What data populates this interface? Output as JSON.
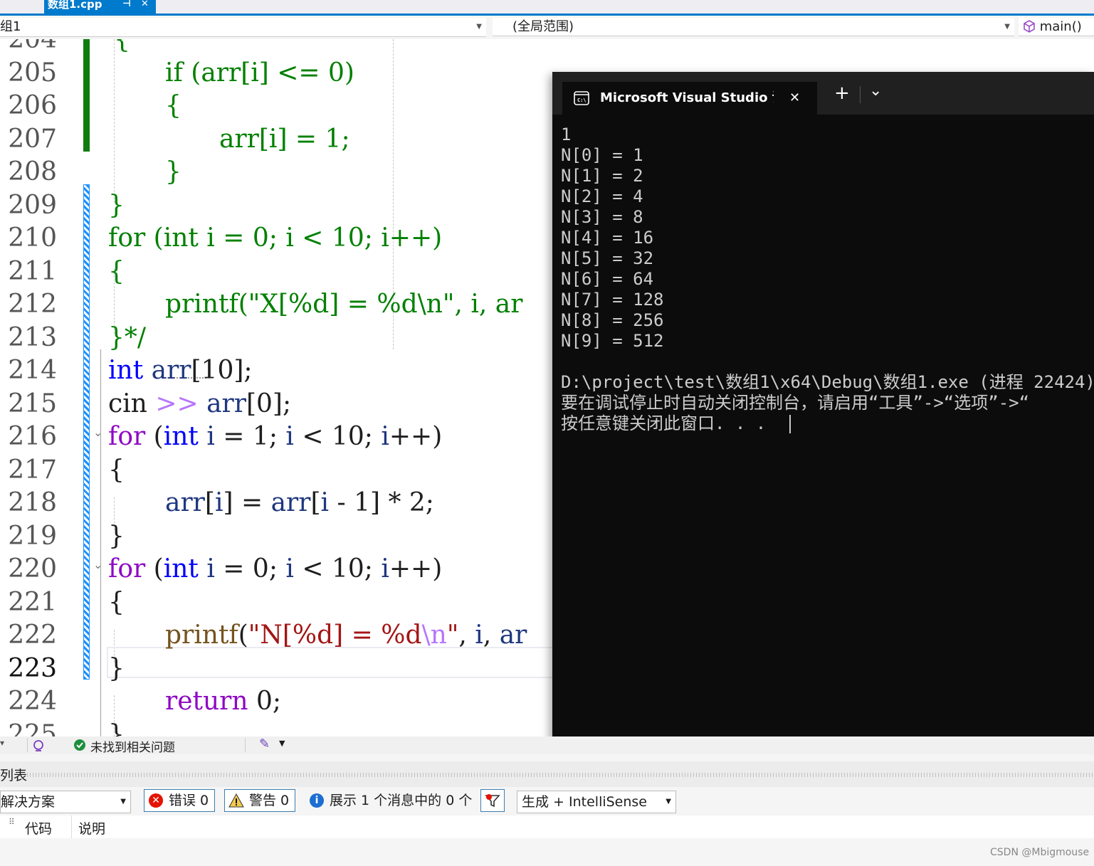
{
  "document_tab": {
    "filename": "数组1.cpp",
    "pin_glyph": "⊣",
    "close_glyph": "✕"
  },
  "navbar": {
    "project": "组1",
    "scope": "(全局范围)",
    "member": "main()"
  },
  "editor": {
    "lines": [
      {
        "num": "204",
        "seg": [
          {
            "t": "{",
            "c": "gc"
          }
        ]
      },
      {
        "num": "205",
        "seg": [
          {
            "t": "if (arr[i] <= 0)",
            "c": "gc"
          }
        ]
      },
      {
        "num": "206",
        "seg": [
          {
            "t": "{",
            "c": "gc"
          }
        ]
      },
      {
        "num": "207",
        "seg": [
          {
            "t": "arr[i] = 1;",
            "c": "gc"
          }
        ]
      },
      {
        "num": "208",
        "seg": [
          {
            "t": "}",
            "c": "gc"
          }
        ]
      },
      {
        "num": "209",
        "seg": [
          {
            "t": "}",
            "c": "gc"
          }
        ]
      },
      {
        "num": "210",
        "seg": [
          {
            "t": "for (int i = 0; i < 10; i++)",
            "c": "gc"
          }
        ]
      },
      {
        "num": "211",
        "seg": [
          {
            "t": "{",
            "c": "gc"
          }
        ]
      },
      {
        "num": "212",
        "seg": [
          {
            "t": "printf(\"X[%d] = %d\\n\", i, ar",
            "c": "gc"
          }
        ]
      },
      {
        "num": "213",
        "seg": [
          {
            "t": "}*/",
            "c": "gc"
          }
        ]
      },
      {
        "num": "214",
        "seg": [
          {
            "t": "int",
            "c": "kw"
          },
          {
            "t": " ",
            "c": ""
          },
          {
            "t": "arr",
            "c": "vr"
          },
          {
            "t": "[10];",
            "c": ""
          }
        ]
      },
      {
        "num": "215",
        "seg": [
          {
            "t": "cin ",
            "c": ""
          },
          {
            "t": ">>",
            "c": "es"
          },
          {
            "t": " ",
            "c": ""
          },
          {
            "t": "arr",
            "c": "vr"
          },
          {
            "t": "[0];",
            "c": ""
          }
        ]
      },
      {
        "num": "216",
        "seg": [
          {
            "t": "for",
            "c": "ctl"
          },
          {
            "t": " (",
            "c": ""
          },
          {
            "t": "int",
            "c": "kw"
          },
          {
            "t": " ",
            "c": ""
          },
          {
            "t": "i",
            "c": "vr"
          },
          {
            "t": " = 1; ",
            "c": ""
          },
          {
            "t": "i",
            "c": "vr"
          },
          {
            "t": " < 10; ",
            "c": ""
          },
          {
            "t": "i",
            "c": "vr"
          },
          {
            "t": "++)",
            "c": ""
          }
        ]
      },
      {
        "num": "217",
        "seg": [
          {
            "t": "{",
            "c": ""
          }
        ]
      },
      {
        "num": "218",
        "seg": [
          {
            "t": "arr",
            "c": "vr"
          },
          {
            "t": "[",
            "c": ""
          },
          {
            "t": "i",
            "c": "vr"
          },
          {
            "t": "] = ",
            "c": ""
          },
          {
            "t": "arr",
            "c": "vr"
          },
          {
            "t": "[",
            "c": ""
          },
          {
            "t": "i",
            "c": "vr"
          },
          {
            "t": " - 1] * 2;",
            "c": ""
          }
        ]
      },
      {
        "num": "219",
        "seg": [
          {
            "t": "}",
            "c": ""
          }
        ]
      },
      {
        "num": "220",
        "seg": [
          {
            "t": "for",
            "c": "ctl"
          },
          {
            "t": " (",
            "c": ""
          },
          {
            "t": "int",
            "c": "kw"
          },
          {
            "t": " ",
            "c": ""
          },
          {
            "t": "i",
            "c": "vr"
          },
          {
            "t": " = 0; ",
            "c": ""
          },
          {
            "t": "i",
            "c": "vr"
          },
          {
            "t": " < 10; ",
            "c": ""
          },
          {
            "t": "i",
            "c": "vr"
          },
          {
            "t": "++)",
            "c": ""
          }
        ]
      },
      {
        "num": "221",
        "seg": [
          {
            "t": "{",
            "c": ""
          }
        ]
      },
      {
        "num": "222",
        "seg": [
          {
            "t": "printf",
            "c": "fn"
          },
          {
            "t": "(",
            "c": ""
          },
          {
            "t": "\"N[%d] = %d",
            "c": "st"
          },
          {
            "t": "\\n",
            "c": "es"
          },
          {
            "t": "\"",
            "c": "st"
          },
          {
            "t": ", ",
            "c": ""
          },
          {
            "t": "i",
            "c": "vr"
          },
          {
            "t": ", ",
            "c": ""
          },
          {
            "t": "ar",
            "c": "vr"
          }
        ]
      },
      {
        "num": "223",
        "seg": [
          {
            "t": "}",
            "c": ""
          }
        ]
      },
      {
        "num": "224",
        "seg": [
          {
            "t": "return",
            "c": "ctl"
          },
          {
            "t": " 0;",
            "c": ""
          }
        ]
      },
      {
        "num": "225",
        "seg": [
          {
            "t": "}",
            "c": ""
          }
        ]
      }
    ]
  },
  "console": {
    "title": "Microsoft Visual Studio 调试",
    "close_glyph": "✕",
    "new_tab_glyph": "+",
    "dropdown_glyph": "⌄",
    "output": "1\nN[0] = 1\nN[1] = 2\nN[2] = 4\nN[3] = 8\nN[4] = 16\nN[5] = 32\nN[6] = 64\nN[7] = 128\nN[8] = 256\nN[9] = 512\n\nD:\\project\\test\\数组1\\x64\\Debug\\数组1.exe (进程 22424)\n要在调试停止时自动关闭控制台，请启用“工具”->“选项”->“\n按任意键关闭此窗口. . ."
  },
  "statusbar": {
    "no_issues": "未找到相关问题"
  },
  "error_list": {
    "title": "列表",
    "scope": "解决方案",
    "errors": "错误 0",
    "warnings": "警告 0",
    "messages": "展示 1 个消息中的 0 个",
    "source_filter": "生成 + IntelliSense",
    "col_code": "代码",
    "col_desc": "说明"
  },
  "watermark": "CSDN @Mbigmouse"
}
